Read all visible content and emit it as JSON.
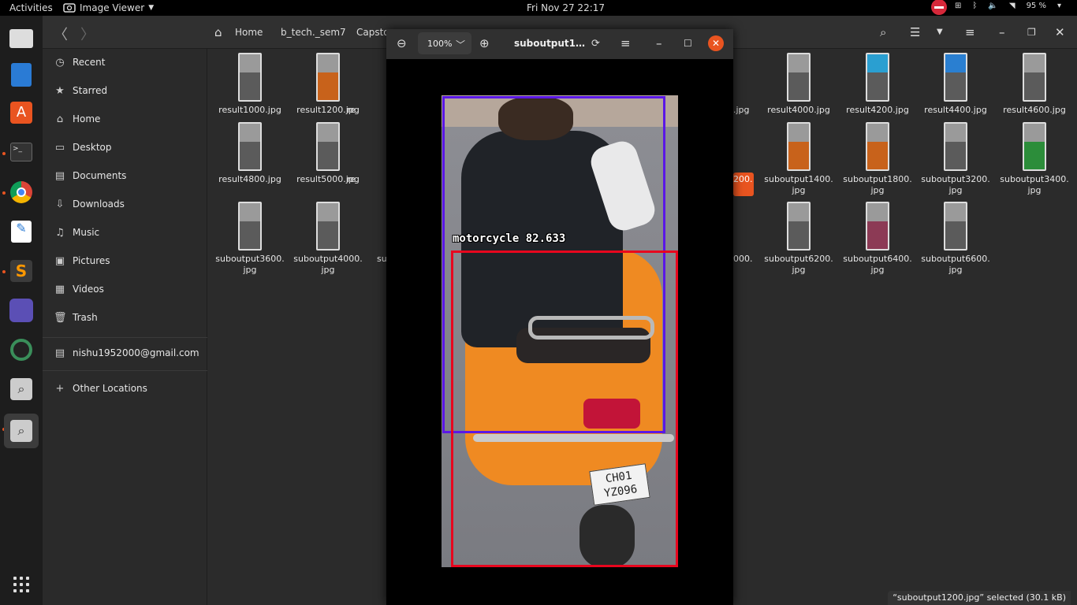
{
  "topbar": {
    "activities": "Activities",
    "app_name": "Image Viewer",
    "clock": "Fri Nov 27  22:17",
    "battery": "95 %"
  },
  "dock": {
    "apps": [
      "files-icon",
      "writer-icon",
      "software-icon",
      "terminal-icon",
      "chrome-icon",
      "text-editor-icon",
      "sublime-icon",
      "network-app-icon",
      "camera-app-icon",
      "search-app-icon",
      "image-viewer-icon"
    ]
  },
  "files": {
    "breadcrumbs": [
      "Home",
      "b_tech._sem7",
      "Capstone"
    ],
    "sidebar": [
      {
        "label": "Recent",
        "icon": "clock-icon"
      },
      {
        "label": "Starred",
        "icon": "star-icon"
      },
      {
        "label": "Home",
        "icon": "home-icon"
      },
      {
        "label": "Desktop",
        "icon": "desktop-icon"
      },
      {
        "label": "Documents",
        "icon": "document-icon"
      },
      {
        "label": "Downloads",
        "icon": "download-icon"
      },
      {
        "label": "Music",
        "icon": "music-icon"
      },
      {
        "label": "Pictures",
        "icon": "pictures-icon"
      },
      {
        "label": "Videos",
        "icon": "video-icon"
      },
      {
        "label": "Trash",
        "icon": "trash-icon"
      }
    ],
    "account": "nishu1952000@gmail.com",
    "other_locations": "Other Locations",
    "grid": [
      {
        "name": "result1000.jpg"
      },
      {
        "name": "result1200.jpg"
      },
      {
        "name": "re"
      },
      {
        "name": "result4000.jpg"
      },
      {
        "name": "result4200.jpg"
      },
      {
        "name": "result4400.jpg"
      },
      {
        "name": "result4600.jpg"
      },
      {
        "name": "result4800.jpg"
      },
      {
        "name": "result5000.jpg"
      },
      {
        "name": "re"
      },
      {
        "name": "suboutput1400.\njpg"
      },
      {
        "name": "suboutput1800.\njpg"
      },
      {
        "name": "suboutput3200.\njpg"
      },
      {
        "name": "suboutput3400.\njpg"
      },
      {
        "name": "suboutput3600.\njpg"
      },
      {
        "name": "suboutput4000.\njpg"
      },
      {
        "name": "su"
      },
      {
        "name": "suboutput6200.\njpg"
      },
      {
        "name": "suboutput6400.\njpg"
      },
      {
        "name": "suboutput6600.\njpg"
      }
    ],
    "partial_labels": [
      ".jpg",
      "200.",
      "000."
    ],
    "status": "“suboutput1200.jpg” selected  (30.1 kB)"
  },
  "viewer": {
    "zoom": "100%",
    "title": "suboutput1…",
    "detection_label": "motorcycle 82.633",
    "plate_text": "CH01\nYZ096",
    "colors": {
      "person_box": "#5a17e6",
      "motorcycle_box": "#e8061e",
      "accent": "#e95420"
    }
  }
}
